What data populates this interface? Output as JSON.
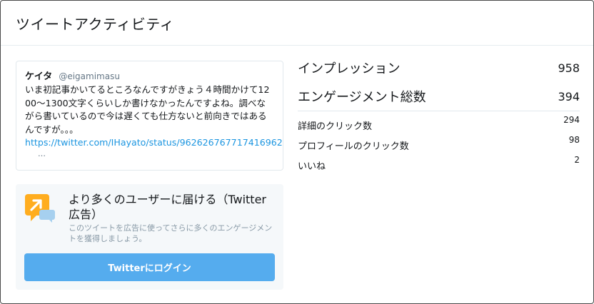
{
  "modal": {
    "title": "ツイートアクティビティ"
  },
  "tweet": {
    "name": "ケイタ",
    "handle": "@eigamimasu",
    "text": "いま初記事かいてるところなんですがきょう４時間かけて1200～1300文字くらいしか書けなかったんですよね。調べながら書いているので今は遅くても仕方ないと前向きではあるんですが。。。",
    "link": "https://twitter.com/IHayato/status/962626767717416962",
    "ellipsis": "…"
  },
  "promo": {
    "title": "より多くのユーザーに届ける（Twitter広告）",
    "description": "このツイートを広告に使ってさらに多くのエンゲージメントを獲得しましょう。",
    "button_label": "Twitterにログイン",
    "icon": "promote-megaphone-icon"
  },
  "stats": {
    "impressions_label": "インプレッション",
    "impressions_value": "958",
    "engagements_label": "エンゲージメント総数",
    "engagements_value": "394",
    "detail_clicks_label": "詳細のクリック数",
    "detail_clicks_value": "294",
    "profile_clicks_label": "プロフィールのクリック数",
    "profile_clicks_value": "98",
    "likes_label": "いいね",
    "likes_value": "2"
  },
  "colors": {
    "accent": "#55acee",
    "link": "#1b95e0",
    "muted": "#8899a6",
    "icon_yellow": "#ffad1f"
  }
}
